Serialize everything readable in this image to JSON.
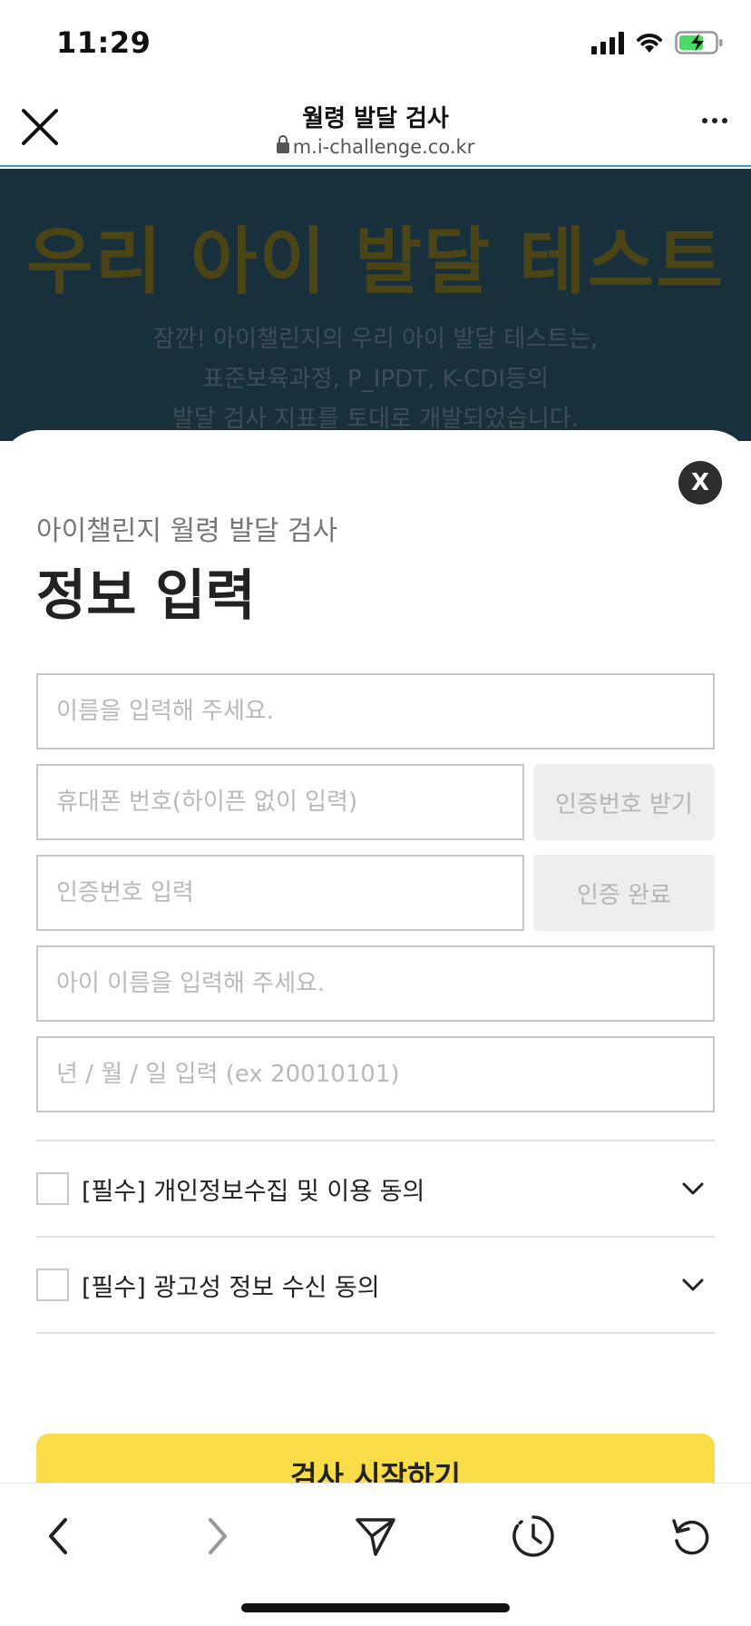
{
  "status_bar": {
    "time": "11:29"
  },
  "browser": {
    "title": "월령 발달 검사",
    "url": "m.i-challenge.co.kr"
  },
  "background": {
    "headline": "우리 아이 발달 테스트",
    "desc_line1": "잠깐! 아이챌린지의 우리 아이 발달 테스트는,",
    "desc_line2": "표준보육과정, P_IPDT, K-CDI등의",
    "desc_line3": "발달 검사 지표를 토대로 개발되었습니다."
  },
  "modal": {
    "close_label": "X",
    "subtitle": "아이챌린지 월령 발달 검사",
    "title": "정보 입력",
    "fields": {
      "name_placeholder": "이름을 입력해 주세요.",
      "phone_placeholder": "휴대폰 번호(하이픈 없이 입력)",
      "get_code_label": "인증번호 받기",
      "code_placeholder": "인증번호 입력",
      "verify_label": "인증 완료",
      "child_name_placeholder": "아이 이름을 입력해 주세요.",
      "birth_placeholder": "년 / 월 / 일 입력 (ex 20010101)"
    },
    "consents": [
      {
        "label": "[필수] 개인정보수집 및 이용 동의"
      },
      {
        "label": "[필수] 광고성 정보 수신 동의"
      }
    ],
    "start_label": "검사 시작하기"
  },
  "colors": {
    "accent": "#f8dc48",
    "header_border": "#3ea0c8",
    "overlay_bg": "#18303c"
  }
}
